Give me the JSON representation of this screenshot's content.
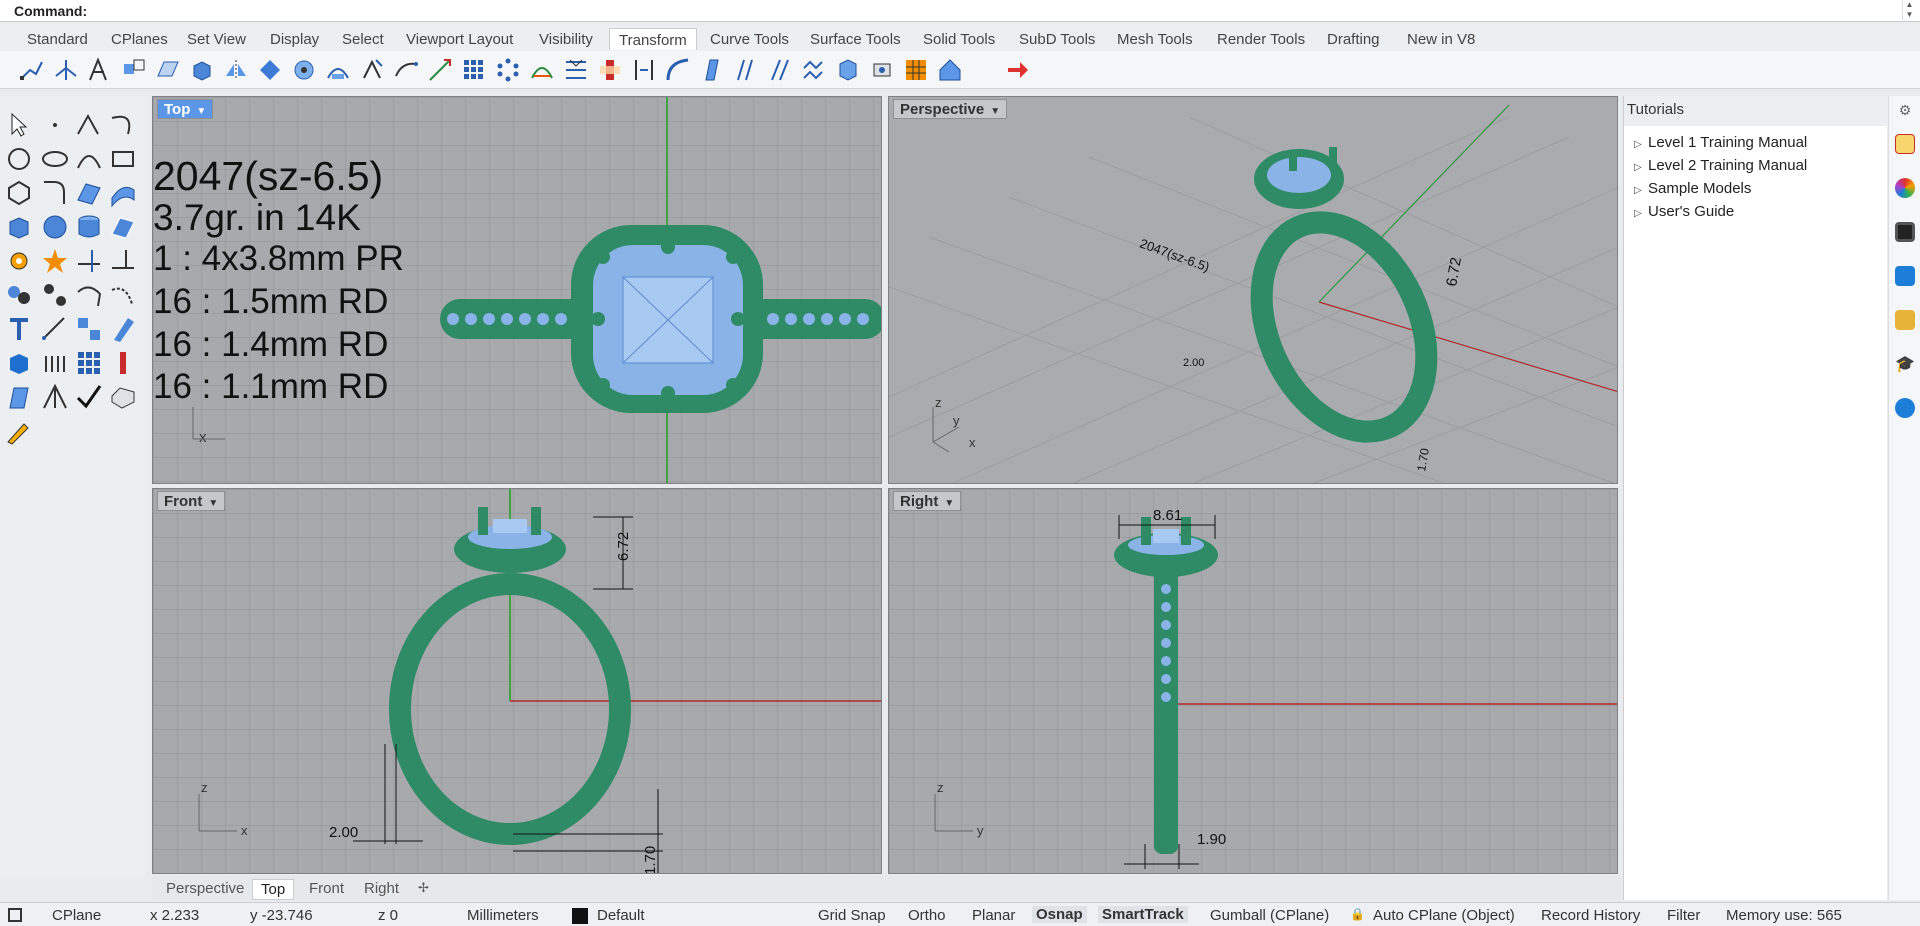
{
  "command": {
    "label": "Command:"
  },
  "tabs": [
    {
      "label": "Standard"
    },
    {
      "label": "CPlanes"
    },
    {
      "label": "Set View"
    },
    {
      "label": "Display"
    },
    {
      "label": "Select"
    },
    {
      "label": "Viewport Layout"
    },
    {
      "label": "Visibility"
    },
    {
      "label": "Transform"
    },
    {
      "label": "Curve Tools"
    },
    {
      "label": "Surface Tools"
    },
    {
      "label": "Solid Tools"
    },
    {
      "label": "SubD Tools"
    },
    {
      "label": "Mesh Tools"
    },
    {
      "label": "Render Tools"
    },
    {
      "label": "Drafting"
    },
    {
      "label": "New in V8"
    }
  ],
  "active_tab": "Transform",
  "viewports": {
    "top": {
      "label": "Top"
    },
    "perspective": {
      "label": "Perspective"
    },
    "front": {
      "label": "Front"
    },
    "right": {
      "label": "Right"
    }
  },
  "annotation": {
    "line1": "2047(sz-6.5)",
    "line2": "3.7gr.  in 14K",
    "line3": "1 : 4x3.8mm PR",
    "line4": "16 : 1.5mm RD",
    "line5": "16 : 1.4mm RD",
    "line6": "16 : 1.1mm RD"
  },
  "dimensions": {
    "front_height": "6.72",
    "front_width": "2.00",
    "front_bottom": "1.70",
    "right_top": "8.61",
    "right_bottom": "1.90",
    "persp_height": "6.72",
    "persp_width": "2.00",
    "persp_bottom": "1.70"
  },
  "axis_labels": {
    "x": "x",
    "y": "y",
    "z": "z"
  },
  "viewport_tabs": [
    {
      "label": "Perspective"
    },
    {
      "label": "Top"
    },
    {
      "label": "Front"
    },
    {
      "label": "Right"
    }
  ],
  "active_viewport_tab": "Top",
  "tutorials": {
    "title": "Tutorials",
    "items": [
      {
        "label": "Level 1 Training Manual"
      },
      {
        "label": "Level 2 Training Manual"
      },
      {
        "label": "Sample Models"
      },
      {
        "label": "User's Guide"
      }
    ]
  },
  "status": {
    "cplane": "CPlane",
    "x": "x 2.233",
    "y": "y -23.746",
    "z": "z 0",
    "units": "Millimeters",
    "layer": "Default",
    "grid_snap": "Grid Snap",
    "ortho": "Ortho",
    "planar": "Planar",
    "osnap": "Osnap",
    "smarttrack": "SmartTrack",
    "gumball": "Gumball (CPlane)",
    "auto_cplane": "Auto CPlane (Object)",
    "record_history": "Record History",
    "filter": "Filter",
    "memory": "Memory use: 565"
  },
  "colors": {
    "ring_metal": "#2e8b66",
    "gems": "#8ab4e8",
    "active_label": "#5b97e6"
  }
}
